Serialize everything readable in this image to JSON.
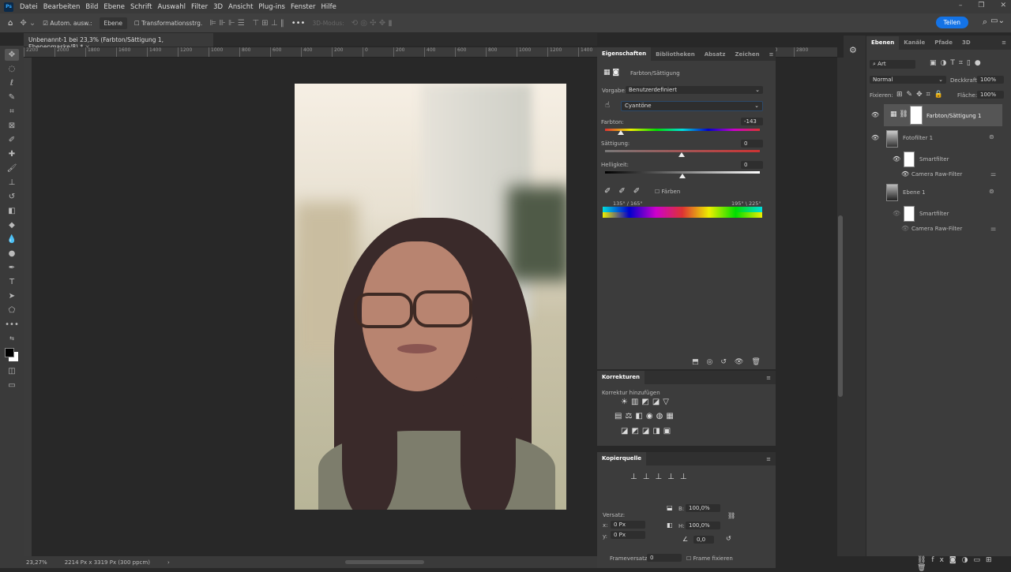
{
  "menu": {
    "items": [
      "Datei",
      "Bearbeiten",
      "Bild",
      "Ebene",
      "Schrift",
      "Auswahl",
      "Filter",
      "3D",
      "Ansicht",
      "Plug-ins",
      "Fenster",
      "Hilfe"
    ]
  },
  "options": {
    "auto_select": "Autom. ausw.:",
    "target": "Ebene",
    "transform": "Transformationsstrg.",
    "mode3d": "3D-Modus:",
    "share": "Teilen"
  },
  "document": {
    "tab": "Unbenannt-1 bei 23,3% (Farbton/Sättigung 1, Ebenenmaske/8) *",
    "zoom": "23,27%",
    "info": "2214 Px x 3319 Px (300 ppcm)"
  },
  "ruler": [
    "2200",
    "2000",
    "1800",
    "1600",
    "1400",
    "1200",
    "1000",
    "800",
    "600",
    "400",
    "200",
    "0",
    "200",
    "400",
    "600",
    "800",
    "1000",
    "1200",
    "1400",
    "1600",
    "1800",
    "2000",
    "2200",
    "2400",
    "2600",
    "2800"
  ],
  "properties": {
    "tabs": [
      "Eigenschaften",
      "Bibliotheken",
      "Absatz",
      "Zeichen"
    ],
    "title": "Farbton/Sättigung",
    "preset_label": "Vorgabe:",
    "preset": "Benutzerdefiniert",
    "range": "Cyantöne",
    "hue_label": "Farbton:",
    "hue": "-143",
    "hue_value": -143,
    "sat_label": "Sättigung:",
    "sat": "0",
    "light_label": "Helligkeit:",
    "light": "0",
    "colorize": "Färben",
    "range_left": "135° / 165°",
    "range_right": "195° \\ 225°"
  },
  "corrections": {
    "title": "Korrekturen",
    "subtitle": "Korrektur hinzufügen"
  },
  "clone_source": {
    "title": "Kopierquelle",
    "offset": "Versatz:",
    "x_label": "x:",
    "x": "0 Px",
    "y_label": "y:",
    "y": "0 Px",
    "w_label": "B:",
    "w": "100,0%",
    "h_label": "H:",
    "h": "100,0%",
    "angle": "0,0",
    "frame_offset_label": "Frameversatz:",
    "frame_offset": "0",
    "lock_frame": "Frame fixieren"
  },
  "layers": {
    "tabs": [
      "Ebenen",
      "Kanäle",
      "Pfade",
      "3D"
    ],
    "filter": "Art",
    "blend": "Normal",
    "opacity_label": "Deckkraft:",
    "opacity": "100%",
    "lock_label": "Fixieren:",
    "fill_label": "Fläche:",
    "fill": "100%",
    "items": [
      {
        "name": "Farbton/Sättigung 1"
      },
      {
        "name": "Fotofilter 1"
      },
      {
        "name": "Smartfilter"
      },
      {
        "name": "Camera Raw-Filter"
      },
      {
        "name": "Ebene 1"
      },
      {
        "name": "Smartfilter"
      },
      {
        "name": "Camera Raw-Filter"
      }
    ]
  },
  "colors": {
    "accent": "#1473e6",
    "panel": "#3c3c3c",
    "canvas": "#282828"
  }
}
